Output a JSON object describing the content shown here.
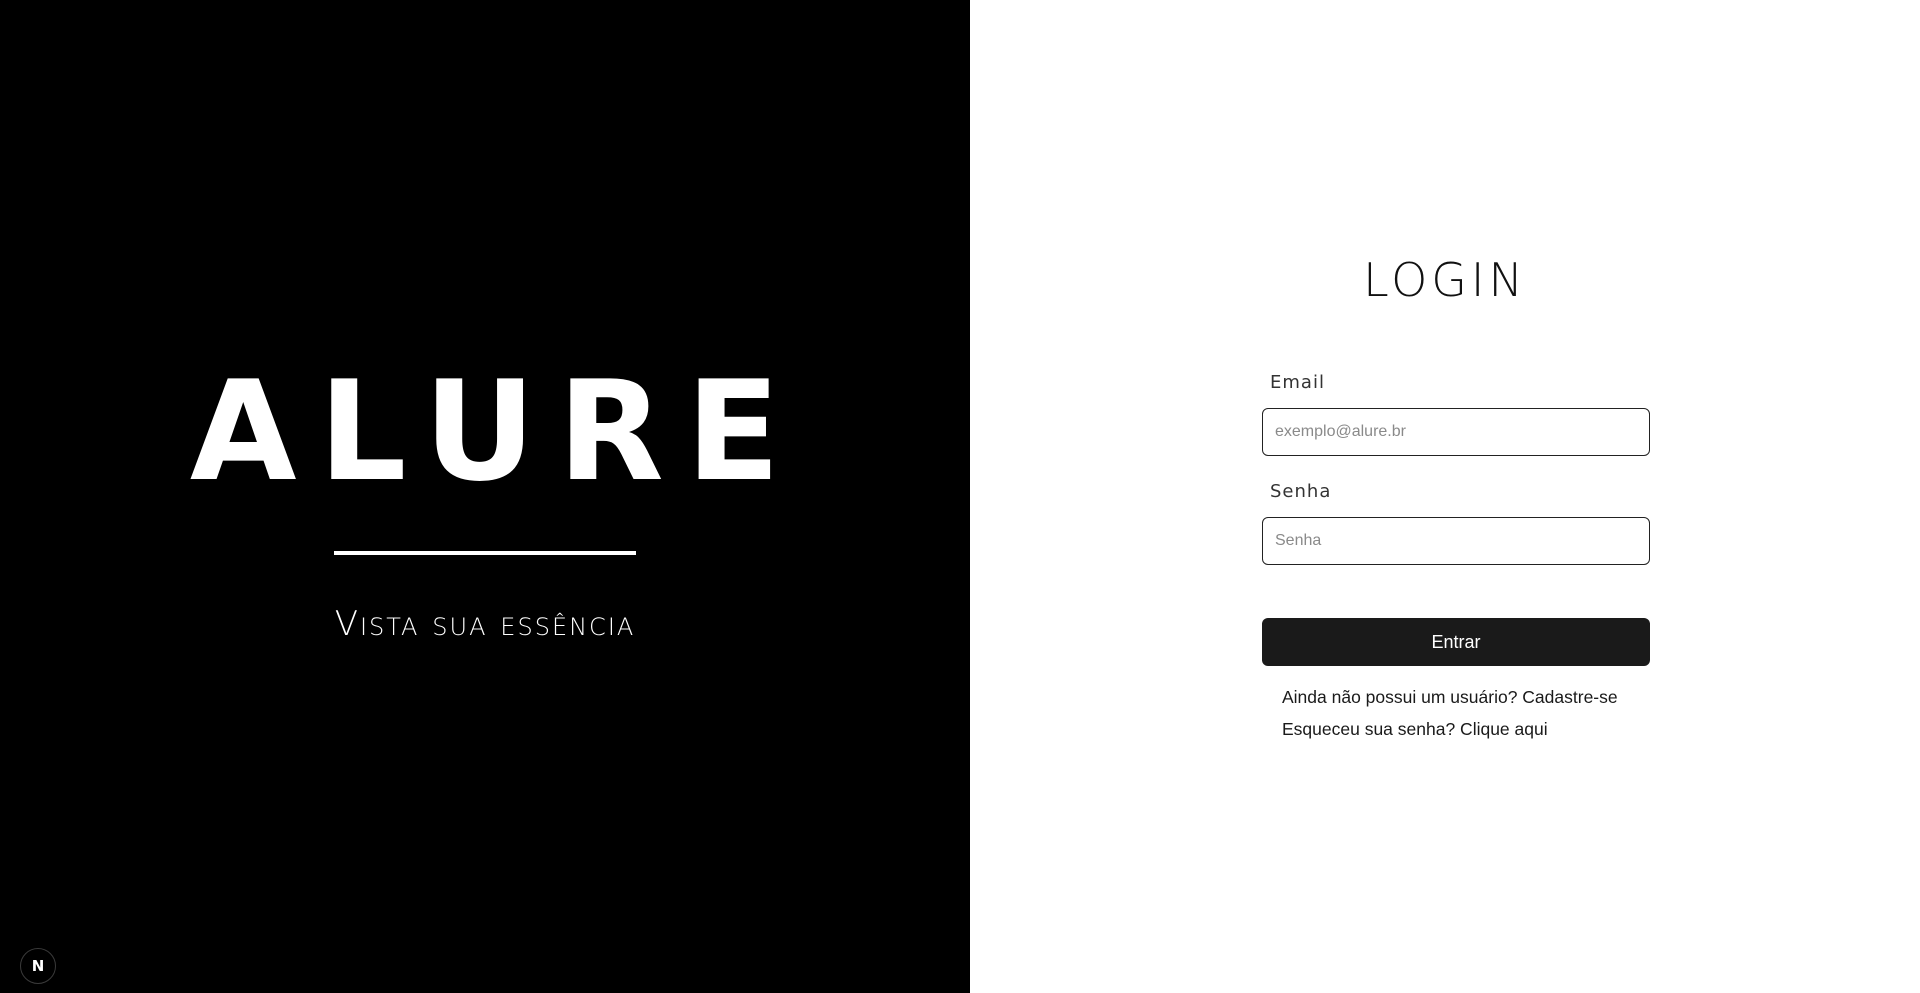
{
  "brand": {
    "logo": "ALURE",
    "tagline": "Vista sua essência",
    "badge": "N"
  },
  "login": {
    "title": "LOGIN",
    "email": {
      "label": "Email",
      "placeholder": "exemplo@alure.br",
      "value": ""
    },
    "password": {
      "label": "Senha",
      "placeholder": "Senha",
      "value": ""
    },
    "submit_label": "Entrar",
    "signup_link": "Ainda não possui um usuário? Cadastre-se",
    "forgot_link": "Esqueceu sua senha? Clique aqui"
  },
  "colors": {
    "brand_background": "#000000",
    "form_background": "#ffffff",
    "button_background": "#1a1a1a"
  }
}
